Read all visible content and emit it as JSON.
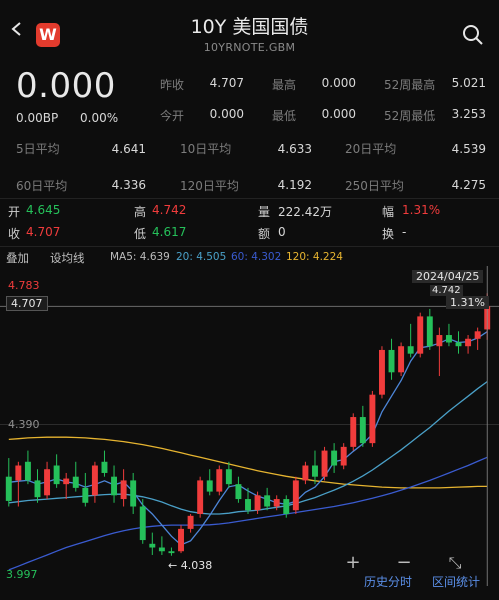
{
  "header": {
    "title": "10Y 美国国债",
    "subtitle": "10YRNOTE.GBM",
    "logo_text": "W"
  },
  "quote": {
    "price": "0.000",
    "change_bp": "0.00BP",
    "change_pct": "0.00%"
  },
  "stats_row1": [
    {
      "label": "昨收",
      "value": "4.707"
    },
    {
      "label": "最高",
      "value": "0.000"
    },
    {
      "label": "52周最高",
      "value": "5.021"
    }
  ],
  "stats_row2": [
    {
      "label": "今开",
      "value": "0.000"
    },
    {
      "label": "最低",
      "value": "0.000"
    },
    {
      "label": "52周最低",
      "value": "3.253"
    }
  ],
  "averages_row1": [
    {
      "label": "5日平均",
      "value": "4.641"
    },
    {
      "label": "10日平均",
      "value": "4.633"
    },
    {
      "label": "20日平均",
      "value": "4.539"
    }
  ],
  "averages_row2": [
    {
      "label": "60日平均",
      "value": "4.336"
    },
    {
      "label": "120日平均",
      "value": "4.192"
    },
    {
      "label": "250日平均",
      "value": "4.275"
    }
  ],
  "ohlc": {
    "open_label": "开",
    "open_value": "4.645",
    "high_label": "高",
    "high_value": "4.742",
    "volume_label": "量",
    "volume_value": "222.42万",
    "amp_label": "幅",
    "amp_value": "1.31%",
    "close_label": "收",
    "close_value": "4.707",
    "low_label": "低",
    "low_value": "4.617",
    "turnover_label": "额",
    "turnover_value": "0",
    "exchange_label": "换",
    "exchange_value": "-"
  },
  "indicator_bar": {
    "overlay_label": "叠加",
    "setline_label": "设均线",
    "ma5": "MA5: 4.639",
    "ma20": "20: 4.505",
    "ma60": "60: 4.302",
    "ma120": "120: 4.224"
  },
  "chart_labels": {
    "top_price": "4.783",
    "ref_price": "4.707",
    "mid_price": "4.390",
    "bottom_price": "3.997",
    "min_marker": "← 4.038",
    "cursor_date": "2024/04/25",
    "cursor_value": "4.742",
    "cursor_pct": "1.31%"
  },
  "controls": {
    "zoom_in": "+",
    "zoom_out": "−",
    "expand": "⤡",
    "history_label": "历史分时",
    "stats_label": "区间统计"
  },
  "colors": {
    "up": "#f03c3c",
    "down": "#25c05a",
    "ma5": "#4d86d8",
    "ma20": "#4aa0c8",
    "ma60": "#3a5bd0",
    "ma120": "#e6b430"
  },
  "chart_data": {
    "type": "candlestick",
    "ylim": [
      3.997,
      4.783
    ],
    "candles": [
      {
        "o": 4.25,
        "h": 4.3,
        "l": 4.17,
        "c": 4.185
      },
      {
        "o": 4.24,
        "h": 4.29,
        "l": 4.17,
        "c": 4.28
      },
      {
        "o": 4.29,
        "h": 4.32,
        "l": 4.23,
        "c": 4.24
      },
      {
        "o": 4.24,
        "h": 4.27,
        "l": 4.18,
        "c": 4.195
      },
      {
        "o": 4.2,
        "h": 4.29,
        "l": 4.19,
        "c": 4.27
      },
      {
        "o": 4.28,
        "h": 4.31,
        "l": 4.22,
        "c": 4.23
      },
      {
        "o": 4.23,
        "h": 4.26,
        "l": 4.19,
        "c": 4.245
      },
      {
        "o": 4.25,
        "h": 4.29,
        "l": 4.21,
        "c": 4.22
      },
      {
        "o": 4.22,
        "h": 4.26,
        "l": 4.17,
        "c": 4.18
      },
      {
        "o": 4.2,
        "h": 4.29,
        "l": 4.18,
        "c": 4.28
      },
      {
        "o": 4.29,
        "h": 4.32,
        "l": 4.25,
        "c": 4.26
      },
      {
        "o": 4.25,
        "h": 4.28,
        "l": 4.18,
        "c": 4.2
      },
      {
        "o": 4.19,
        "h": 4.27,
        "l": 4.17,
        "c": 4.24
      },
      {
        "o": 4.24,
        "h": 4.26,
        "l": 4.15,
        "c": 4.17
      },
      {
        "o": 4.17,
        "h": 4.19,
        "l": 4.07,
        "c": 4.08
      },
      {
        "o": 4.07,
        "h": 4.1,
        "l": 4.04,
        "c": 4.06
      },
      {
        "o": 4.06,
        "h": 4.09,
        "l": 4.04,
        "c": 4.05
      },
      {
        "o": 4.05,
        "h": 4.06,
        "l": 4.038,
        "c": 4.045
      },
      {
        "o": 4.05,
        "h": 4.12,
        "l": 4.045,
        "c": 4.11
      },
      {
        "o": 4.11,
        "h": 4.15,
        "l": 4.1,
        "c": 4.145
      },
      {
        "o": 4.15,
        "h": 4.25,
        "l": 4.14,
        "c": 4.24
      },
      {
        "o": 4.24,
        "h": 4.27,
        "l": 4.2,
        "c": 4.21
      },
      {
        "o": 4.21,
        "h": 4.28,
        "l": 4.2,
        "c": 4.27
      },
      {
        "o": 4.27,
        "h": 4.29,
        "l": 4.22,
        "c": 4.23
      },
      {
        "o": 4.23,
        "h": 4.25,
        "l": 4.18,
        "c": 4.19
      },
      {
        "o": 4.19,
        "h": 4.22,
        "l": 4.15,
        "c": 4.16
      },
      {
        "o": 4.16,
        "h": 4.21,
        "l": 4.15,
        "c": 4.2
      },
      {
        "o": 4.2,
        "h": 4.22,
        "l": 4.16,
        "c": 4.17
      },
      {
        "o": 4.17,
        "h": 4.2,
        "l": 4.16,
        "c": 4.19
      },
      {
        "o": 4.19,
        "h": 4.2,
        "l": 4.14,
        "c": 4.15
      },
      {
        "o": 4.16,
        "h": 4.25,
        "l": 4.15,
        "c": 4.24
      },
      {
        "o": 4.24,
        "h": 4.29,
        "l": 4.23,
        "c": 4.28
      },
      {
        "o": 4.28,
        "h": 4.32,
        "l": 4.23,
        "c": 4.25
      },
      {
        "o": 4.25,
        "h": 4.33,
        "l": 4.24,
        "c": 4.32
      },
      {
        "o": 4.32,
        "h": 4.34,
        "l": 4.26,
        "c": 4.28
      },
      {
        "o": 4.28,
        "h": 4.34,
        "l": 4.27,
        "c": 4.33
      },
      {
        "o": 4.33,
        "h": 4.42,
        "l": 4.32,
        "c": 4.41
      },
      {
        "o": 4.41,
        "h": 4.44,
        "l": 4.33,
        "c": 4.34
      },
      {
        "o": 4.34,
        "h": 4.48,
        "l": 4.33,
        "c": 4.47
      },
      {
        "o": 4.47,
        "h": 4.6,
        "l": 4.46,
        "c": 4.59
      },
      {
        "o": 4.59,
        "h": 4.62,
        "l": 4.51,
        "c": 4.53
      },
      {
        "o": 4.53,
        "h": 4.61,
        "l": 4.52,
        "c": 4.6
      },
      {
        "o": 4.6,
        "h": 4.66,
        "l": 4.57,
        "c": 4.58
      },
      {
        "o": 4.58,
        "h": 4.69,
        "l": 4.57,
        "c": 4.68
      },
      {
        "o": 4.68,
        "h": 4.7,
        "l": 4.59,
        "c": 4.6
      },
      {
        "o": 4.6,
        "h": 4.65,
        "l": 4.52,
        "c": 4.63
      },
      {
        "o": 4.63,
        "h": 4.66,
        "l": 4.6,
        "c": 4.61
      },
      {
        "o": 4.61,
        "h": 4.64,
        "l": 4.58,
        "c": 4.6
      },
      {
        "o": 4.6,
        "h": 4.63,
        "l": 4.58,
        "c": 4.62
      },
      {
        "o": 4.62,
        "h": 4.65,
        "l": 4.59,
        "c": 4.64
      },
      {
        "o": 4.645,
        "h": 4.742,
        "l": 4.617,
        "c": 4.707
      }
    ],
    "ma5": [
      4.235,
      4.238,
      4.24,
      4.23,
      4.236,
      4.244,
      4.236,
      4.232,
      4.222,
      4.229,
      4.239,
      4.228,
      4.236,
      4.21,
      4.174,
      4.15,
      4.12,
      4.09,
      4.067,
      4.078,
      4.11,
      4.146,
      4.186,
      4.223,
      4.228,
      4.212,
      4.198,
      4.19,
      4.18,
      4.176,
      4.184,
      4.208,
      4.222,
      4.25,
      4.29,
      4.296,
      4.318,
      4.338,
      4.364,
      4.424,
      4.466,
      4.508,
      4.56,
      4.596,
      4.6,
      4.608,
      4.62,
      4.61,
      4.612,
      4.622,
      4.639
    ],
    "ma20": [
      4.18,
      4.183,
      4.186,
      4.188,
      4.19,
      4.192,
      4.194,
      4.196,
      4.198,
      4.2,
      4.202,
      4.203,
      4.203,
      4.2,
      4.196,
      4.19,
      4.182,
      4.172,
      4.163,
      4.156,
      4.152,
      4.15,
      4.15,
      4.152,
      4.156,
      4.158,
      4.16,
      4.164,
      4.168,
      4.172,
      4.178,
      4.186,
      4.194,
      4.204,
      4.214,
      4.225,
      4.238,
      4.252,
      4.268,
      4.286,
      4.304,
      4.322,
      4.342,
      4.362,
      4.382,
      4.404,
      4.426,
      4.446,
      4.466,
      4.486,
      4.505
    ],
    "ma60": [
      4.0,
      4.01,
      4.02,
      4.03,
      4.04,
      4.05,
      4.06,
      4.068,
      4.076,
      4.084,
      4.092,
      4.099,
      4.105,
      4.11,
      4.114,
      4.117,
      4.119,
      4.12,
      4.12,
      4.12,
      4.12,
      4.121,
      4.123,
      4.126,
      4.13,
      4.134,
      4.138,
      4.142,
      4.146,
      4.15,
      4.154,
      4.158,
      4.162,
      4.166,
      4.17,
      4.175,
      4.18,
      4.186,
      4.192,
      4.199,
      4.206,
      4.214,
      4.222,
      4.231,
      4.24,
      4.25,
      4.26,
      4.27,
      4.28,
      4.291,
      4.302
    ],
    "ma120": [
      4.35,
      4.352,
      4.354,
      4.355,
      4.356,
      4.356,
      4.356,
      4.355,
      4.354,
      4.352,
      4.35,
      4.347,
      4.344,
      4.34,
      4.336,
      4.331,
      4.326,
      4.32,
      4.314,
      4.308,
      4.302,
      4.296,
      4.29,
      4.284,
      4.278,
      4.272,
      4.266,
      4.261,
      4.256,
      4.251,
      4.247,
      4.243,
      4.239,
      4.236,
      4.233,
      4.23,
      4.228,
      4.226,
      4.224,
      4.222,
      4.221,
      4.22,
      4.22,
      4.22,
      4.22,
      4.22,
      4.221,
      4.222,
      4.223,
      4.224,
      4.224
    ]
  }
}
